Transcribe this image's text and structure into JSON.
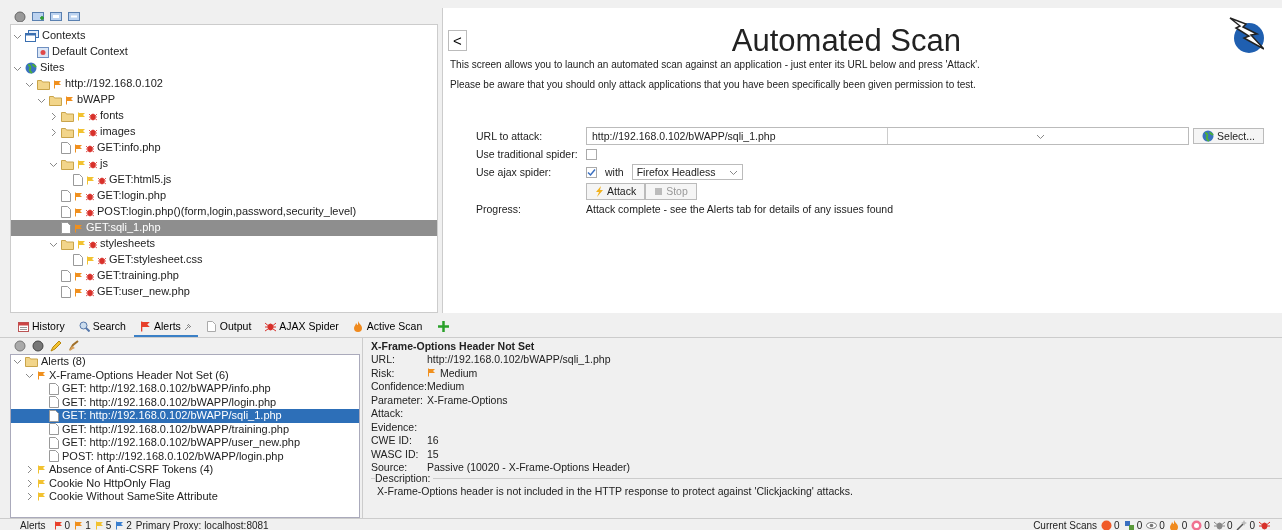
{
  "sites_tree": [
    {
      "label": "Contexts",
      "kind": "contexts",
      "expanded": true,
      "selected": false,
      "children": [
        {
          "label": "Default Context",
          "kind": "context",
          "selected": false
        }
      ]
    },
    {
      "label": "Sites",
      "kind": "globe",
      "expanded": true,
      "selected": false,
      "children": [
        {
          "label": "http://192.168.0.102",
          "kind": "folder",
          "color": "#f0901e",
          "spider": false,
          "expanded": true,
          "selected": false,
          "children": [
            {
              "label": "bWAPP",
              "kind": "folder",
              "color": "#f0901e",
              "spider": false,
              "expanded": true,
              "selected": false,
              "children": [
                {
                  "label": "fonts",
                  "kind": "folder",
                  "color": "#f2c230",
                  "spider": true,
                  "expanded": false,
                  "selected": false
                },
                {
                  "label": "images",
                  "kind": "folder",
                  "color": "#f2c230",
                  "spider": true,
                  "expanded": false,
                  "selected": false
                },
                {
                  "label": "GET:info.php",
                  "kind": "file",
                  "color": "#f0901e",
                  "spider": true,
                  "selected": false
                },
                {
                  "label": "js",
                  "kind": "folder",
                  "color": "#f2c230",
                  "spider": true,
                  "expanded": true,
                  "selected": false,
                  "children": [
                    {
                      "label": "GET:html5.js",
                      "kind": "file",
                      "color": "#f2c230",
                      "spider": true,
                      "selected": false
                    }
                  ]
                },
                {
                  "label": "GET:login.php",
                  "kind": "file",
                  "color": "#f0901e",
                  "spider": true,
                  "selected": false
                },
                {
                  "label": "POST:login.php()(form,login,password,security_level)",
                  "kind": "file",
                  "color": "#f0901e",
                  "spider": true,
                  "selected": false
                },
                {
                  "label": "GET:sqli_1.php",
                  "kind": "file",
                  "color": "#f0901e",
                  "spider": false,
                  "selected": true
                },
                {
                  "label": "stylesheets",
                  "kind": "folder",
                  "color": "#f2c230",
                  "spider": true,
                  "expanded": true,
                  "selected": false,
                  "children": [
                    {
                      "label": "GET:stylesheet.css",
                      "kind": "file",
                      "color": "#f2c230",
                      "spider": true,
                      "selected": false
                    }
                  ]
                },
                {
                  "label": "GET:training.php",
                  "kind": "file",
                  "color": "#f0901e",
                  "spider": true,
                  "selected": false
                },
                {
                  "label": "GET:user_new.php",
                  "kind": "file",
                  "color": "#f0901e",
                  "spider": true,
                  "selected": false
                }
              ]
            }
          ]
        }
      ]
    }
  ],
  "scan_panel": {
    "back": "<",
    "title": "Automated Scan",
    "intro": [
      "This screen allows you to launch an automated scan against  an application - just enter its URL below and press 'Attack'.",
      "Please be aware that you should only attack applications that you have been specifically been given permission to test."
    ],
    "fields": [
      {
        "kind": "url",
        "label": "URL to attack:",
        "value": "http://192.168.0.102/bWAPP/sqli_1.php",
        "button": "Select..."
      },
      {
        "kind": "checkbox",
        "label": "Use traditional spider:",
        "checked": false
      },
      {
        "kind": "ajax",
        "label": "Use ajax spider:",
        "checked": true,
        "with": "with",
        "browser": "Firefox Headless"
      },
      {
        "kind": "buttons",
        "buttons": [
          {
            "label": "Attack",
            "kind": "bolt",
            "disabled": false
          },
          {
            "label": "Stop",
            "kind": "stop",
            "disabled": true
          }
        ]
      },
      {
        "kind": "text",
        "label": "Progress:",
        "value": "Attack complete - see the Alerts tab for details of any issues found"
      }
    ]
  },
  "bottom_tabs": [
    {
      "label": "History",
      "kind": "calendar",
      "selected": false
    },
    {
      "label": "Search",
      "kind": "search",
      "selected": false
    },
    {
      "label": "Alerts",
      "kind": "flag",
      "selected": true
    },
    {
      "label": "Output",
      "kind": "file",
      "selected": false
    },
    {
      "label": "AJAX Spider",
      "kind": "spider",
      "selected": false
    },
    {
      "label": "Active Scan",
      "kind": "flame",
      "selected": false
    }
  ],
  "alerts_tree": [
    {
      "label": "Alerts (8)",
      "kind": "folder",
      "expanded": true,
      "selected": false,
      "children": [
        {
          "label": "X-Frame-Options Header Not Set (6)",
          "color": "#f0901e",
          "expanded": true,
          "selected": false,
          "children": [
            {
              "label": "GET: http://192.168.0.102/bWAPP/info.php",
              "kind": "file",
              "selected": false
            },
            {
              "label": "GET: http://192.168.0.102/bWAPP/login.php",
              "kind": "file",
              "selected": false
            },
            {
              "label": "GET: http://192.168.0.102/bWAPP/sqli_1.php",
              "kind": "file",
              "selected": true
            },
            {
              "label": "GET: http://192.168.0.102/bWAPP/training.php",
              "kind": "file",
              "selected": false
            },
            {
              "label": "GET: http://192.168.0.102/bWAPP/user_new.php",
              "kind": "file",
              "selected": false
            },
            {
              "label": "POST: http://192.168.0.102/bWAPP/login.php",
              "kind": "file",
              "selected": false
            }
          ]
        },
        {
          "label": "Absence of Anti-CSRF Tokens (4)",
          "color": "#f2c230",
          "expanded": false,
          "selected": false
        },
        {
          "label": "Cookie No HttpOnly Flag",
          "color": "#f2c230",
          "expanded": false,
          "selected": false
        },
        {
          "label": "Cookie Without SameSite Attribute",
          "color": "#f2c230",
          "expanded": false,
          "selected": false
        }
      ]
    }
  ],
  "alert_detail": {
    "title": "X-Frame-Options Header Not Set",
    "rows": [
      {
        "label": "URL:",
        "value": "http://192.168.0.102/bWAPP/sqli_1.php"
      },
      {
        "label": "Risk:",
        "value": "Medium",
        "color": "#f0901e"
      },
      {
        "label": "Confidence:",
        "value": "Medium"
      },
      {
        "label": "Parameter:",
        "value": "X-Frame-Options"
      },
      {
        "label": "Attack:"
      },
      {
        "label": "Evidence:"
      },
      {
        "label": "CWE ID:",
        "value": "16"
      },
      {
        "label": "WASC ID:",
        "value": "15"
      },
      {
        "label": "Source:",
        "value": "Passive (10020 - X-Frame-Options Header)"
      }
    ],
    "description_label": "Description:",
    "description": "X-Frame-Options header is not included in the HTTP response to protect against 'Clickjacking' attacks."
  },
  "status_bar": {
    "label": "Alerts",
    "counts": [
      {
        "color": "#e8402a",
        "count": "0"
      },
      {
        "color": "#f0901e",
        "count": "1"
      },
      {
        "color": "#f2c230",
        "count": "5"
      },
      {
        "color": "#3a7fd0",
        "count": "2"
      }
    ],
    "proxy": "Primary Proxy: localhost:8081",
    "scans_label": "Current Scans",
    "scans": [
      {
        "kind": "dot",
        "count": "0"
      },
      {
        "kind": "plugin",
        "count": "0"
      },
      {
        "kind": "eye",
        "count": "0"
      },
      {
        "kind": "flame",
        "count": "0"
      },
      {
        "kind": "target",
        "count": "0"
      },
      {
        "kind": "web",
        "count": "0"
      },
      {
        "kind": "wand",
        "count": "0"
      },
      {
        "kind": "spider"
      }
    ]
  }
}
